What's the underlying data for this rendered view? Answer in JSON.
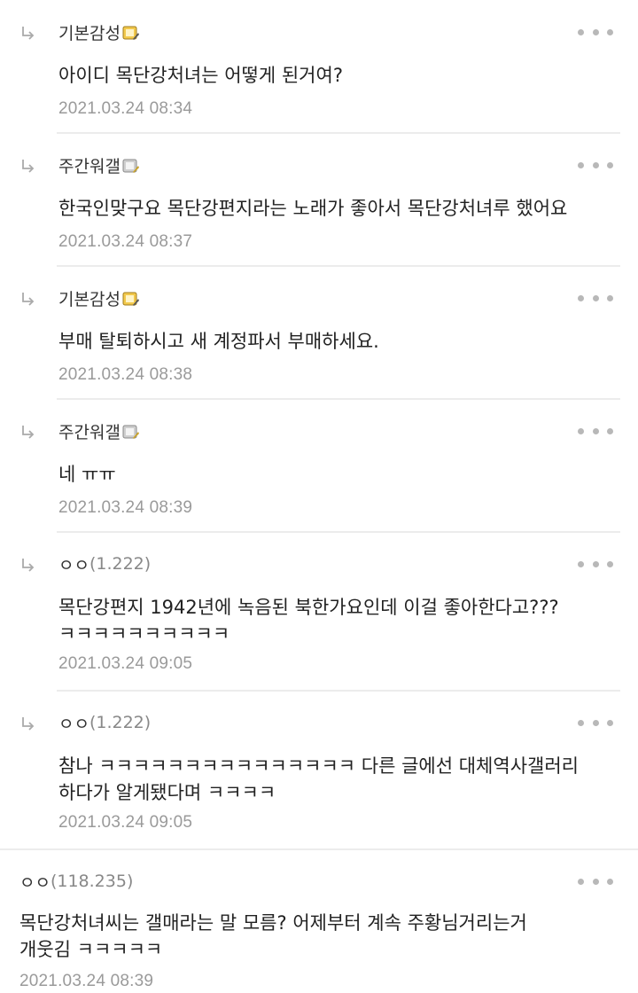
{
  "comments": [
    {
      "author": "기본감성",
      "ip": "",
      "badge": "gold",
      "text": "아이디 목단강처녀는 어떻게 된거여?",
      "date": "2021.03.24 08:34"
    },
    {
      "author": "주간워갤",
      "ip": "",
      "badge": "gray",
      "text": "한국인맞구요 목단강편지라는 노래가 좋아서 목단강처녀루 했어요",
      "date": "2021.03.24 08:37"
    },
    {
      "author": "기본감성",
      "ip": "",
      "badge": "gold",
      "text": "부매 탈퇴하시고 새 계정파서 부매하세요.",
      "date": "2021.03.24 08:38"
    },
    {
      "author": "주간워갤",
      "ip": "",
      "badge": "gray",
      "text": "네 ㅠㅠ",
      "date": "2021.03.24 08:39"
    },
    {
      "author": "ㅇㅇ",
      "ip": "(1.222)",
      "badge": "",
      "text": "목단강편지 1942년에 녹음된 북한가요인데 이걸 좋아한다고???\nㅋㅋㅋㅋㅋㅋㅋㅋㅋㅋ",
      "date": "2021.03.24 09:05"
    },
    {
      "author": "ㅇㅇ",
      "ip": "(1.222)",
      "badge": "",
      "text": "참나 ㅋㅋㅋㅋㅋㅋㅋㅋㅋㅋㅋㅋㅋㅋㅋ 다른 글에선 대체역사갤러리\n하다가 알게됐다며 ㅋㅋㅋㅋ",
      "date": "2021.03.24 09:05"
    },
    {
      "author": "ㅇㅇ",
      "ip": "(118.235)",
      "badge": "",
      "text": "목단강처녀씨는 갤매라는 말 모름? 어제부터 계속 주황님거리는거\n개웃김 ㅋㅋㅋㅋㅋ",
      "date": "2021.03.24 08:39"
    }
  ]
}
